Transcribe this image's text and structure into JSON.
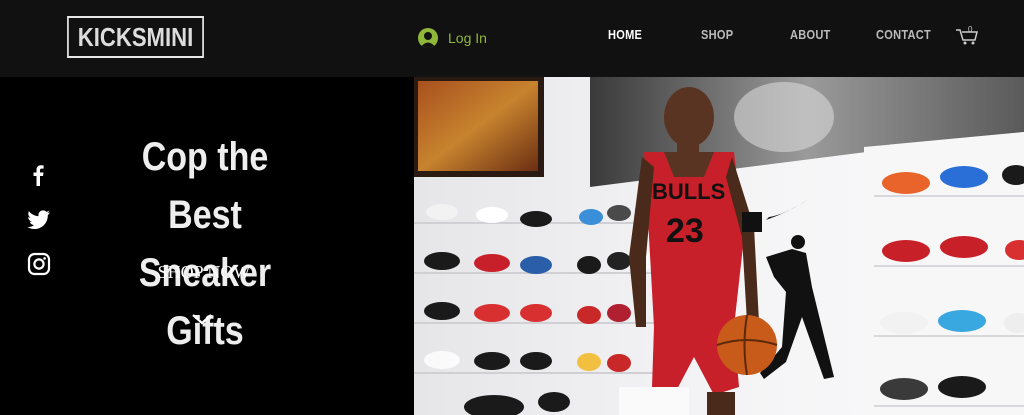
{
  "header": {
    "logo": "KICKSMINI",
    "login_label": "Log In",
    "nav": [
      {
        "label": "HOME",
        "active": true
      },
      {
        "label": "SHOP",
        "active": false
      },
      {
        "label": "ABOUT",
        "active": false
      },
      {
        "label": "CONTACT",
        "active": false
      }
    ],
    "cart_count": "0"
  },
  "hero": {
    "title_line1": "Cop the Best",
    "title_line2": "Sneaker Gifts",
    "cta": "SHOP NOW"
  },
  "social": [
    "facebook-icon",
    "twitter-icon",
    "instagram-icon"
  ],
  "photo": {
    "jersey_text": "BULLS",
    "jersey_number": "23",
    "alt": "Michael Jordan figure in front of wall of mini sneakers"
  },
  "colors": {
    "accent": "#8fb83a",
    "background": "#000000",
    "header": "#111111"
  }
}
